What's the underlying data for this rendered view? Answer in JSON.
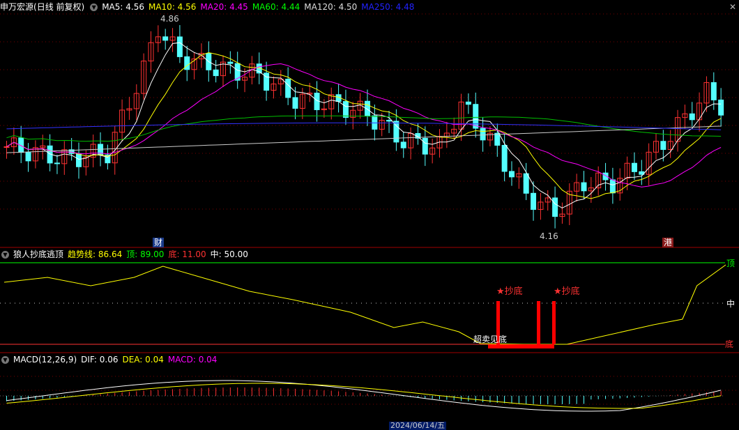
{
  "header": {
    "stock_name": "申万宏源",
    "period": "(日线 前复权)",
    "ma": [
      {
        "label": "MA5: 4.56",
        "color": "#ffffff"
      },
      {
        "label": "MA10: 4.56",
        "color": "#ffff00"
      },
      {
        "label": "MA20: 4.45",
        "color": "#ff00ff"
      },
      {
        "label": "MA60: 4.44",
        "color": "#00ff00"
      },
      {
        "label": "MA120: 4.50",
        "color": "#cccccc"
      },
      {
        "label": "MA250: 4.48",
        "color": "#0000ff"
      }
    ]
  },
  "price_chart": {
    "high_label": "4.86",
    "low_label": "4.16",
    "event_marks": [
      "财",
      "港"
    ]
  },
  "indicator": {
    "name": "狼人抄底逃顶",
    "trend_label": "趋势线: 86.64",
    "top_label": "顶: 89.00",
    "bottom_label": "底: 11.00",
    "mid_label": "中: 50.00",
    "right_top": "顶",
    "right_mid": "中",
    "right_bottom": "底",
    "signal_1": "★抄底",
    "signal_2": "★抄底",
    "oversold_text": "超卖见底"
  },
  "macd": {
    "name": "MACD(12,26,9)",
    "dif_label": "DIF: 0.06",
    "dea_label": "DEA: 0.04",
    "macd_label": "MACD: 0.04",
    "date_label": "2024/06/14/五"
  },
  "colors": {
    "up": "#ff3232",
    "down": "#54ffff",
    "grid": "#7a0000",
    "yellow": "#ffff00",
    "magenta": "#ff00ff",
    "green": "#00c000",
    "blue": "#3333ff"
  }
}
